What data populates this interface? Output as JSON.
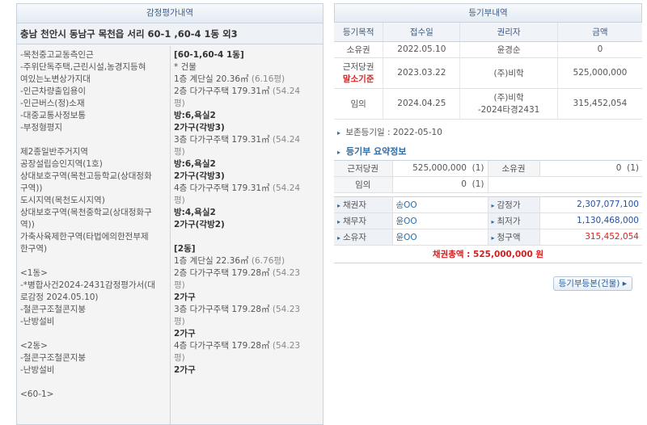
{
  "left": {
    "title": "감정평가내역",
    "address": "충남 천안시 동남구 목천읍 서리 60-1 ,60-4 1동 외3",
    "col1": [
      "-목천중고교동측인근",
      "-주위단독주택,근린시설,농경지등혀",
      "여있는노변상가지대",
      "-인근차량출입용이",
      "-인근버스(정)소재",
      "-대중교통사정보통",
      "-부정형평지",
      "",
      "제2종일반주거지역",
      "공장설립승인지역(1호)",
      "상대보호구역(목천고등학교(상대정화",
      "구역))",
      "도시지역(목천도시지역)",
      "상대보호구역(목천중학교(상대정화구",
      "역))",
      "가축사육제한구역(타법에의한전부제",
      "한구역)",
      "",
      "<1동>",
      "-*병합사건2024-2431감정평가서(대",
      "로감정 2024.05.10)",
      "-철콘구조철콘지붕",
      "-난방설비",
      "",
      "<2동>",
      "-철콘구조철콘지붕",
      "-난방설비",
      "",
      "<60-1>"
    ],
    "col2": [
      {
        "t": "[60-1,60-4 1동]",
        "c": "b"
      },
      {
        "t": "* 건물",
        "c": ""
      },
      {
        "t": "1층 계단실 20.36㎡ (6.16평)",
        "c": ""
      },
      {
        "t": "2층 다가구주택 179.31㎡ (54.24",
        "c": ""
      },
      {
        "t": "평)",
        "c": ""
      },
      {
        "t": "방:6,욕실2",
        "c": "b"
      },
      {
        "t": "2가구(각방3)",
        "c": "b"
      },
      {
        "t": "3층 다가구주택 179.31㎡ (54.24",
        "c": ""
      },
      {
        "t": "평)",
        "c": ""
      },
      {
        "t": "방:6,욕실2",
        "c": "b"
      },
      {
        "t": "2가구(각방3)",
        "c": "b"
      },
      {
        "t": "4층 다가구주택 179.31㎡ (54.24",
        "c": ""
      },
      {
        "t": "평)",
        "c": ""
      },
      {
        "t": "방:4,욕실2",
        "c": "b"
      },
      {
        "t": "2가구(각방2)",
        "c": "b"
      },
      {
        "t": "",
        "c": ""
      },
      {
        "t": "[2동]",
        "c": "b"
      },
      {
        "t": "1층 계단실 22.36㎡ (6.76평)",
        "c": ""
      },
      {
        "t": "2층 다가구주택 179.28㎡ (54.23",
        "c": ""
      },
      {
        "t": "평)",
        "c": ""
      },
      {
        "t": "2가구",
        "c": "b"
      },
      {
        "t": "3층 다가구주택 179.28㎡ (54.23",
        "c": ""
      },
      {
        "t": "평)",
        "c": ""
      },
      {
        "t": "2가구",
        "c": "b"
      },
      {
        "t": "4층 다가구주택 179.28㎡ (54.23",
        "c": ""
      },
      {
        "t": "평)",
        "c": ""
      },
      {
        "t": "2가구",
        "c": "b"
      }
    ]
  },
  "right": {
    "title": "등기부내역",
    "headers": [
      "등기목적",
      "접수일",
      "권리자",
      "금액"
    ],
    "rows": [
      {
        "purpose": "소유권",
        "purpose2": "",
        "date": "2022.05.10",
        "holder": "윤경순",
        "holder2": "",
        "amount": "0",
        "red": false
      },
      {
        "purpose": "근저당권",
        "purpose2": "말소기준",
        "date": "2023.03.22",
        "holder": "(주)비학",
        "holder2": "",
        "amount": "525,000,000",
        "red": false
      },
      {
        "purpose": "임의",
        "purpose2": "",
        "date": "2024.04.25",
        "holder": "(주)비학",
        "holder2": "-2024타경2431",
        "amount": "315,452,054",
        "red": true
      }
    ],
    "preserve_label": "보존등기일 : 2022-05-10",
    "summary_title": "등기부 요약정보",
    "summary": {
      "row1": {
        "l1": "근저당권",
        "v1": "525,000,000",
        "c1": "(1)",
        "l2": "소유권",
        "v2": "0",
        "c2": "(1)"
      },
      "row2": {
        "l1": "임의",
        "v1": "0",
        "c1": "(1)"
      }
    },
    "parties": [
      {
        "l": "채권자",
        "v": "송OO",
        "r": "감정가",
        "rv": "2,307,077,100",
        "rc": "blue"
      },
      {
        "l": "채무자",
        "v": "윤OO",
        "r": "최저가",
        "rv": "1,130,468,000",
        "rc": "blue"
      },
      {
        "l": "소유자",
        "v": "윤OO",
        "r": "청구액",
        "rv": "315,452,054",
        "rc": "red"
      }
    ],
    "total": "채권총액 : 525,000,000 원",
    "button": "등기부등본(건물) ▸"
  }
}
